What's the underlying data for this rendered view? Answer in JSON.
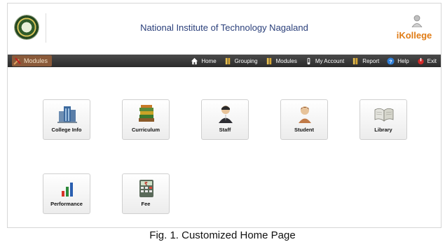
{
  "header": {
    "institute_title": "National Institute of Technology Nagaland",
    "brand_name": "iKollege"
  },
  "nav": {
    "active_tab": "Modules",
    "items": [
      {
        "label": "Home",
        "icon": "home-icon"
      },
      {
        "label": "Grouping",
        "icon": "book-icon"
      },
      {
        "label": "Modules",
        "icon": "book-icon"
      },
      {
        "label": "My Account",
        "icon": "account-icon"
      },
      {
        "label": "Report",
        "icon": "book-icon"
      },
      {
        "label": "Help",
        "icon": "help-icon"
      },
      {
        "label": "Exit",
        "icon": "exit-icon"
      }
    ]
  },
  "modules": [
    {
      "label": "College Info",
      "icon": "building-icon"
    },
    {
      "label": "Curriculum",
      "icon": "books-stack-icon"
    },
    {
      "label": "Staff",
      "icon": "staff-person-icon"
    },
    {
      "label": "Student",
      "icon": "student-person-icon"
    },
    {
      "label": "Library",
      "icon": "open-book-icon"
    },
    {
      "label": "Performance",
      "icon": "bar-graph-icon"
    },
    {
      "label": "Fee",
      "icon": "fee-calculator-icon"
    }
  ],
  "caption": "Fig. 1. Customized Home Page",
  "colors": {
    "title_blue": "#2a3f7a",
    "brand_orange": "#e07b14",
    "navbar_dark": "#2b2b2b",
    "modules_tab": "#8a5a3a"
  }
}
